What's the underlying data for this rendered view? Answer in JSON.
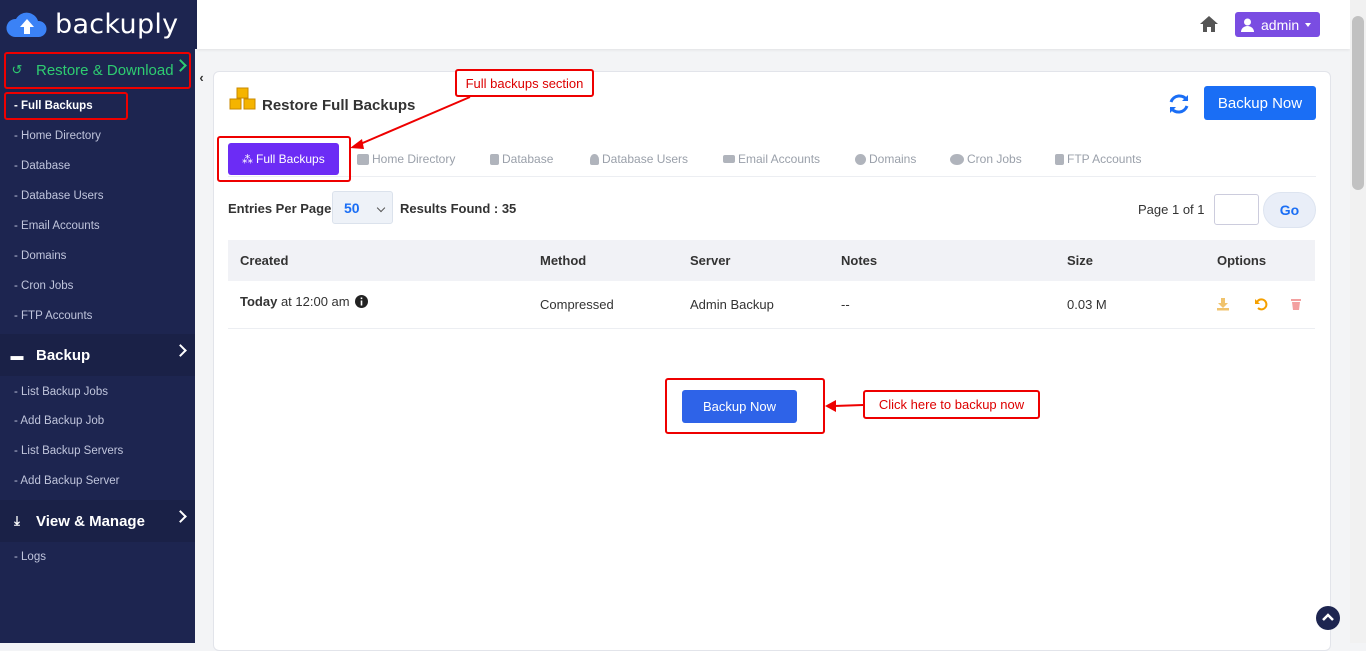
{
  "brand": {
    "name": "backuply"
  },
  "sidebar": {
    "restore_section": "Restore & Download",
    "restore_items": [
      "- Full Backups",
      "- Home Directory",
      "- Database",
      "- Database Users",
      "- Email Accounts",
      "- Domains",
      "- Cron Jobs",
      "- FTP Accounts"
    ],
    "backup_section": "Backup",
    "backup_items": [
      "- List Backup Jobs",
      "- Add Backup Job",
      "- List Backup Servers",
      "- Add Backup Server"
    ],
    "view_section": "View & Manage",
    "view_items": [
      "- Logs"
    ],
    "collapse": "‹"
  },
  "topbar": {
    "user": "admin"
  },
  "page": {
    "title": "Restore Full Backups",
    "backup_now": "Backup Now",
    "tabs": [
      "Full Backups",
      "Home Directory",
      "Database",
      "Database Users",
      "Email Accounts",
      "Domains",
      "Cron Jobs",
      "FTP Accounts"
    ],
    "entries_label": "Entries Per Page",
    "entries_value": "50",
    "results": "Results Found : 35",
    "page_info": "Page 1 of 1",
    "go": "Go"
  },
  "table": {
    "headers": [
      "Created",
      "Method",
      "Server",
      "Notes",
      "Size",
      "Options"
    ],
    "rows": [
      {
        "created_bold": "Today",
        "created_rest": " at 12:00 am",
        "method": "Compressed",
        "server": "Admin Backup",
        "notes": "--",
        "size": "0.03 M"
      }
    ]
  },
  "center_button": "Backup Now",
  "annotations": {
    "full_backups": "Full backups section",
    "backup_now": "Click here to backup now"
  },
  "colors": {
    "sidebar": "#1d2550",
    "accent": "#6c2cf5",
    "primary": "#1a6ef5",
    "highlight": "#e00000",
    "active_green": "#2ecc71"
  }
}
